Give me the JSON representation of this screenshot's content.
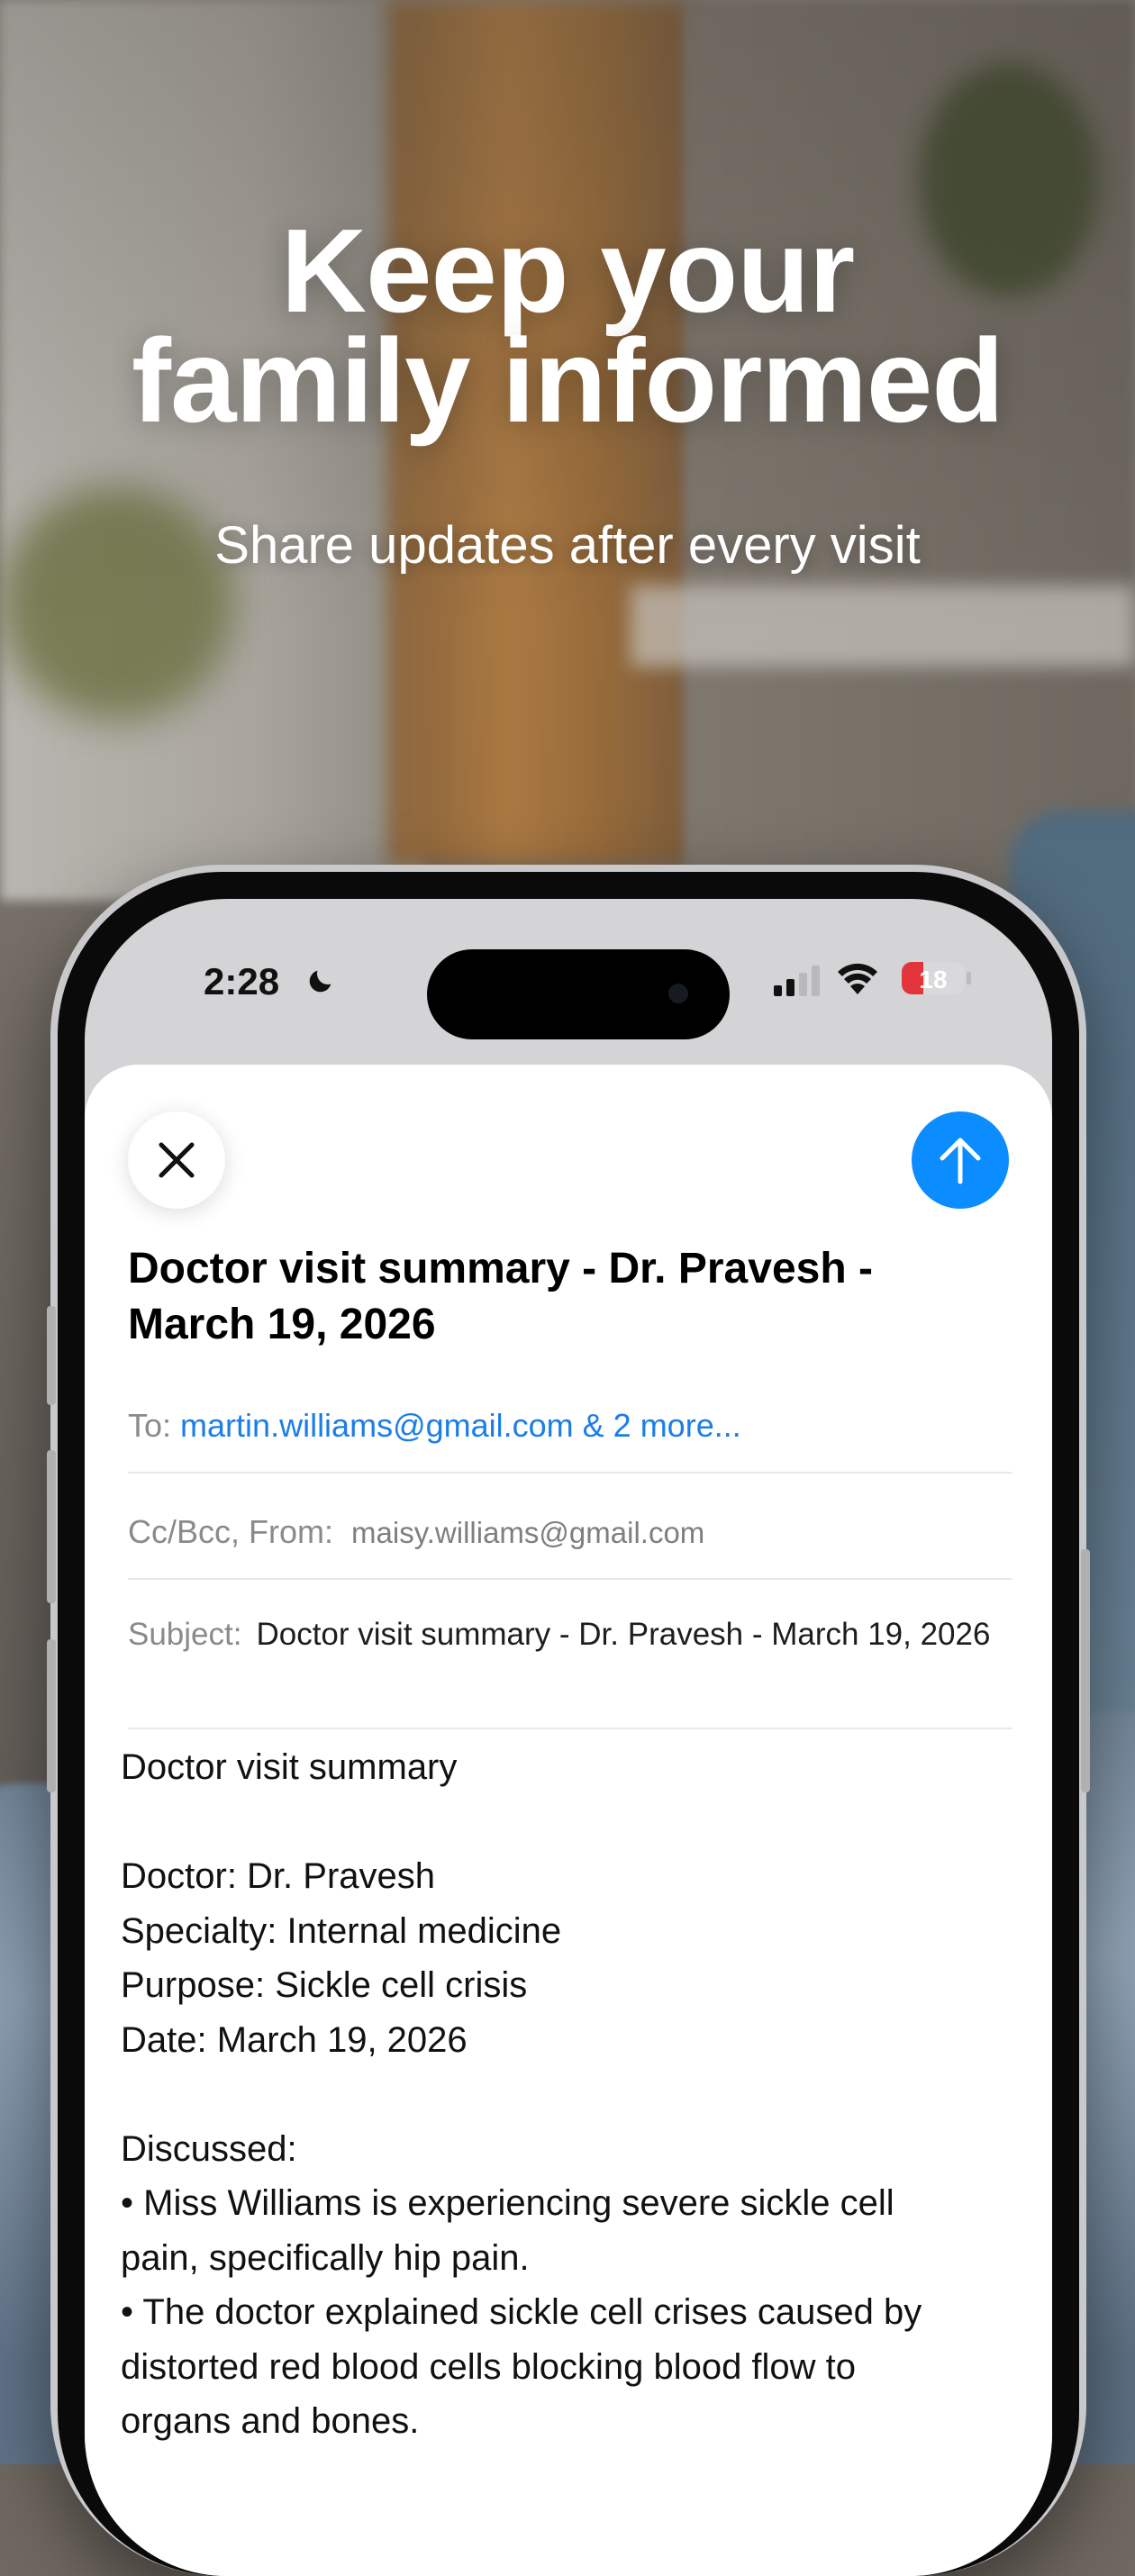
{
  "promo": {
    "headline_line1": "Keep your",
    "headline_line2": "family informed",
    "subheadline": "Share updates after every visit"
  },
  "status_bar": {
    "time": "2:28",
    "battery": "18",
    "icons": [
      "moon-icon",
      "signal-icon",
      "wifi-icon",
      "battery-icon"
    ]
  },
  "compose": {
    "close_icon": "close-icon",
    "send_icon": "arrow-up-icon",
    "title_line1": "Doctor visit summary - Dr. Pravesh -",
    "title_line2": "March 19, 2026",
    "to_label": "To:",
    "to_value": "martin.williams@gmail.com & 2 more...",
    "ccbcc_label": "Cc/Bcc, From:",
    "from_value": "maisy.williams@gmail.com",
    "subject_label": "Subject:",
    "subject_value": "Doctor visit summary - Dr. Pravesh - March 19, 2026",
    "body_lines": [
      "Doctor visit summary",
      "",
      "Doctor: Dr. Pravesh",
      "Specialty: Internal medicine",
      "Purpose: Sickle cell crisis",
      "Date: March 19, 2026",
      "",
      "Discussed:",
      "• Miss Williams is experiencing severe sickle cell",
      "pain, specifically hip pain.",
      "• The doctor explained sickle cell crises caused by",
      "distorted red blood cells blocking blood flow to",
      "organs and bones."
    ]
  },
  "colors": {
    "accent": "#0b8cff",
    "link": "#1b7ee8"
  }
}
